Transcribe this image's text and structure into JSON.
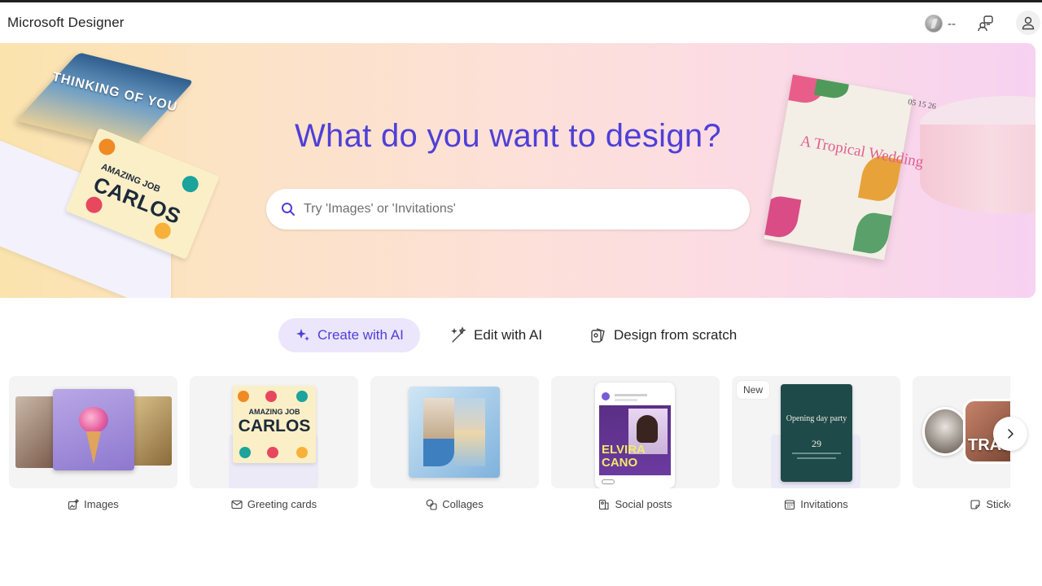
{
  "header": {
    "app_title": "Microsoft Designer",
    "credits": "--",
    "icons": {
      "credits": "coin-icon",
      "share": "share-icon",
      "account": "account-icon"
    }
  },
  "hero": {
    "title": "What do you want to design?",
    "search_placeholder": "Try 'Images' or 'Invitations'",
    "search_value": "",
    "art": {
      "sky_card_text": "THINKING OF YOU",
      "greeting_card_subtitle": "AMAZING JOB",
      "greeting_card_name": "CARLOS",
      "invite_title": "A Tropical Wedding",
      "invite_date": "05 15 26"
    }
  },
  "mode_tabs": [
    {
      "label": "Create with AI",
      "icon": "sparkle-icon",
      "active": true
    },
    {
      "label": "Edit with AI",
      "icon": "magic-wand-icon",
      "active": false
    },
    {
      "label": "Design from scratch",
      "icon": "scratch-icon",
      "active": false
    }
  ],
  "categories": [
    {
      "label": "Images",
      "icon": "image-sparkle-icon",
      "badge": ""
    },
    {
      "label": "Greeting cards",
      "icon": "envelope-icon",
      "badge": "",
      "thumb_subtitle": "AMAZING JOB",
      "thumb_name": "CARLOS"
    },
    {
      "label": "Collages",
      "icon": "collage-icon",
      "badge": ""
    },
    {
      "label": "Social posts",
      "icon": "social-post-icon",
      "badge": "",
      "thumb_name_1": "ELVIRA",
      "thumb_name_2": "CANO"
    },
    {
      "label": "Invitations",
      "icon": "calendar-icon",
      "badge": "New",
      "thumb_title": "Opening day party",
      "thumb_date": "29"
    },
    {
      "label": "Stickers",
      "icon": "sticker-icon",
      "badge": "",
      "thumb_text": "TRAV"
    }
  ],
  "carousel": {
    "next_icon": "chevron-right-icon"
  },
  "colors": {
    "accent": "#4f3fd8",
    "active_tab_bg": "#ebe6fb"
  }
}
